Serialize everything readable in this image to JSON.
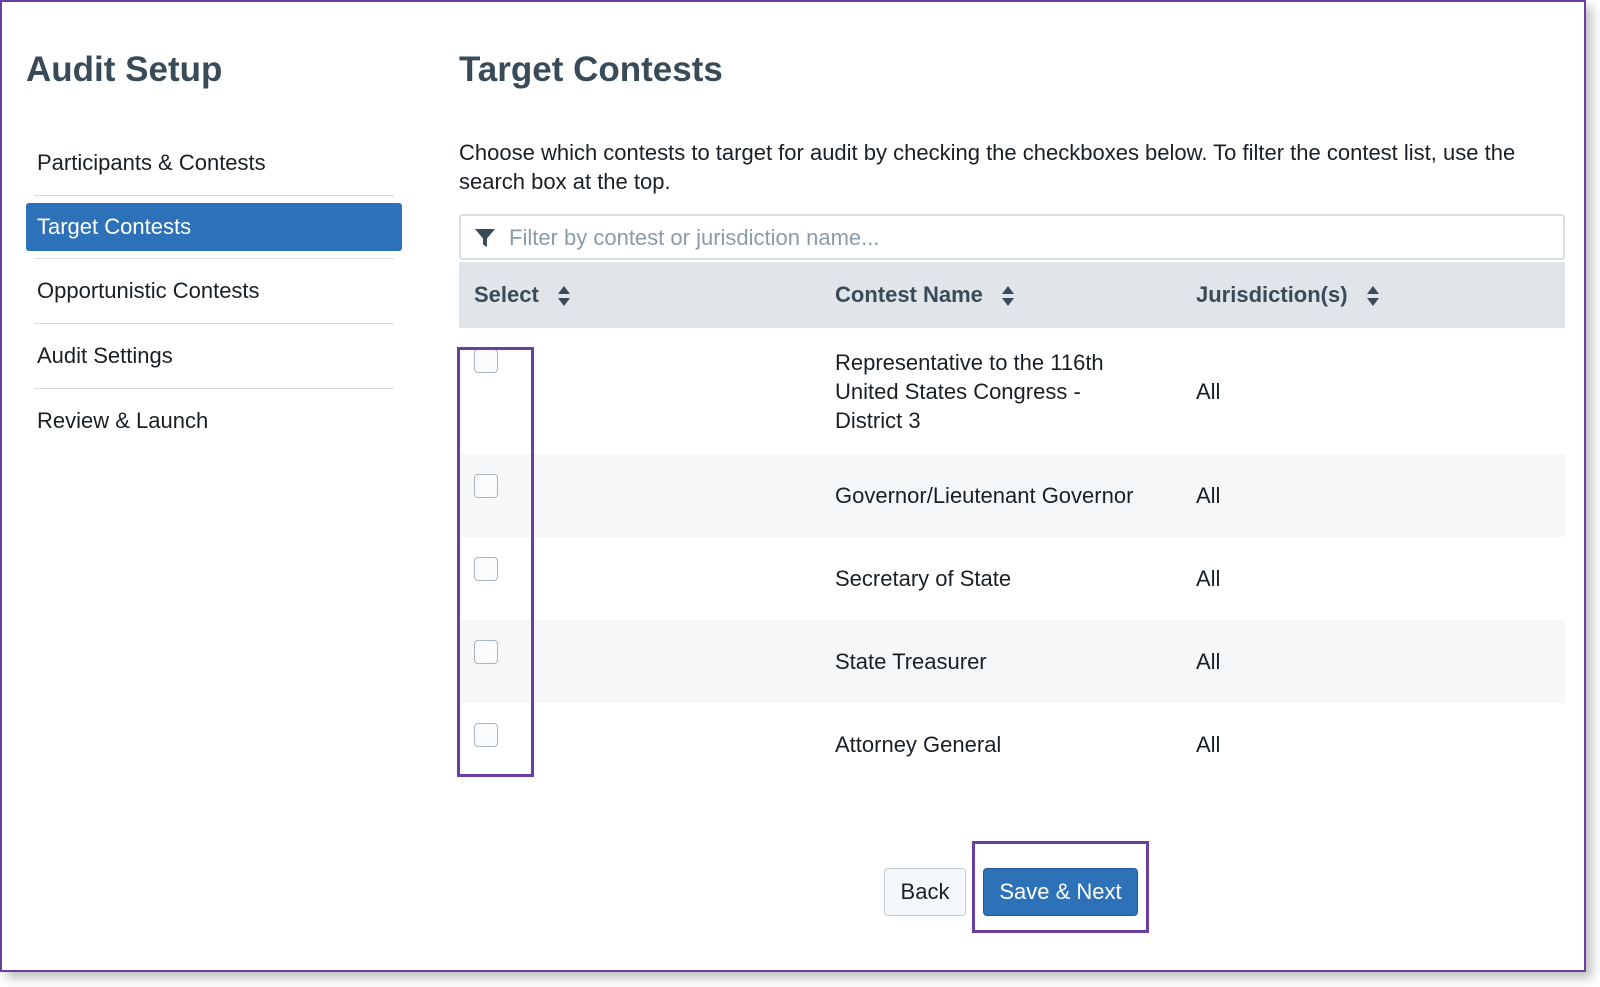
{
  "sidebar": {
    "title": "Audit Setup",
    "items": [
      {
        "label": "Participants & Contests"
      },
      {
        "label": "Target Contests"
      },
      {
        "label": "Opportunistic Contests"
      },
      {
        "label": "Audit Settings"
      },
      {
        "label": "Review & Launch"
      }
    ],
    "active_index": 1
  },
  "main": {
    "title": "Target Contests",
    "description": "Choose which contests to target for audit by checking the checkboxes below. To filter the contest list, use the search box at the top.",
    "search": {
      "placeholder": "Filter by contest or jurisdiction name...",
      "value": ""
    },
    "table": {
      "headers": [
        "Select",
        "Contest Name",
        "Jurisdiction(s)"
      ],
      "rows": [
        {
          "contest": "Representative to the 116th United States Congress - District 3",
          "jurisdiction": "All",
          "selected": false
        },
        {
          "contest": "Governor/Lieutenant Governor",
          "jurisdiction": "All",
          "selected": false
        },
        {
          "contest": "Secretary of State",
          "jurisdiction": "All",
          "selected": false
        },
        {
          "contest": "State Treasurer",
          "jurisdiction": "All",
          "selected": false
        },
        {
          "contest": "Attorney General",
          "jurisdiction": "All",
          "selected": false
        }
      ]
    }
  },
  "buttons": {
    "back": "Back",
    "save_next": "Save & Next"
  },
  "colors": {
    "primary": "#2d72b8",
    "highlight": "#6b3fa0",
    "header_bg": "#e1e5e9",
    "title": "#394b59"
  },
  "icons": {
    "filter": "filter-icon",
    "sort": "sort-icon"
  }
}
